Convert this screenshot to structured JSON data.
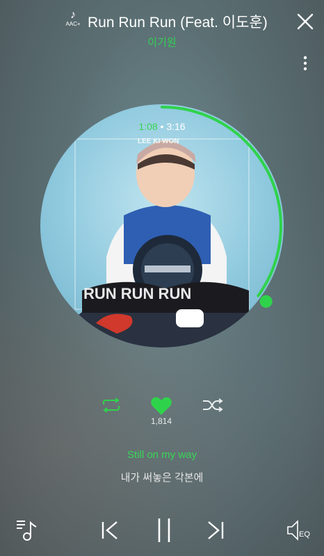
{
  "header": {
    "codec_badge": "AAC+",
    "song_title": "Run Run Run (Feat. 이도훈)",
    "artist": "이기원"
  },
  "player": {
    "current_time": "1:08",
    "separator": "•",
    "total_time": "3:16",
    "progress": 0.35,
    "album_text_top": "LEE KI WON",
    "album_text_bottom": "RUN RUN RUN"
  },
  "actions": {
    "likes_count": "1,814"
  },
  "lyrics": {
    "current_line": "Still on my way",
    "next_line": "내가 써놓은 각본에"
  },
  "bottom_bar": {
    "eq_label": "EQ"
  },
  "colors": {
    "accent": "#2fd34b"
  }
}
